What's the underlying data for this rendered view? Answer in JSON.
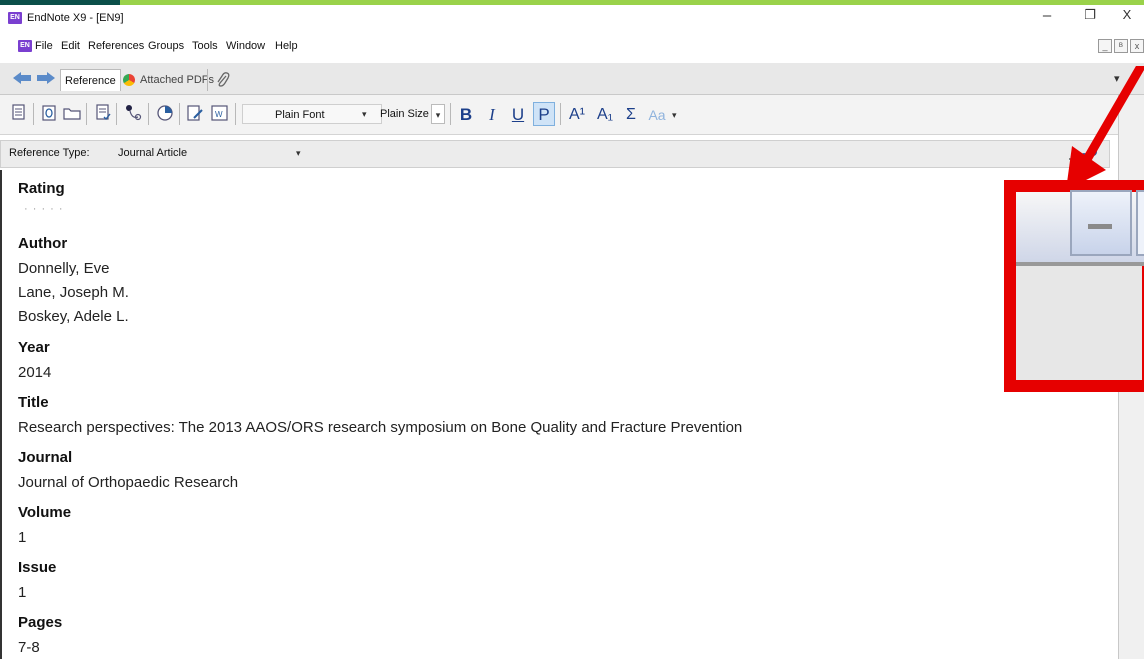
{
  "window": {
    "title": "EndNote X9 - [EN9]",
    "app_icon": "EN",
    "minimize": "–",
    "restore": "❐",
    "close": "X"
  },
  "menu": {
    "items": [
      "File",
      "Edit",
      "References",
      "Groups",
      "Tools",
      "Window",
      "Help"
    ],
    "mdi_buttons": [
      "_",
      "ᴮ",
      "x"
    ]
  },
  "tabs": {
    "reference": "Reference",
    "attached_pdfs": "Attached PDFs",
    "menu_marker": "▾"
  },
  "format": {
    "font": "Plain Font",
    "size": "Plain Size",
    "bold": "B",
    "italic": "I",
    "underline": "U",
    "plain": "P",
    "superscript": "A¹",
    "subscript": "A₁",
    "symbol": "Σ",
    "case": "Aa"
  },
  "reference": {
    "type_label": "Reference Type:",
    "type_value": "Journal Article",
    "fields": [
      {
        "label": "Rating",
        "values": [
          "·   ·   ·   ·   ·"
        ]
      },
      {
        "label": "Author",
        "values": [
          "Donnelly, Eve",
          "Lane, Joseph M.",
          "Boskey, Adele L."
        ]
      },
      {
        "label": "Year",
        "values": [
          "2014"
        ]
      },
      {
        "label": "Title",
        "values": [
          "Research perspectives: The 2013 AAOS/ORS research symposium on Bone Quality and Fracture Prevention"
        ]
      },
      {
        "label": "Journal",
        "values": [
          "Journal of Orthopaedic Research"
        ]
      },
      {
        "label": "Volume",
        "values": [
          "1"
        ]
      },
      {
        "label": "Issue",
        "values": [
          "1"
        ]
      },
      {
        "label": "Pages",
        "values": [
          "7-8"
        ]
      }
    ]
  },
  "icons": {
    "back": "back-arrow-icon",
    "forward": "forward-arrow-icon",
    "pdf": "chrome-pdf-icon",
    "paperclip": "paperclip-icon",
    "gear": "gear-icon"
  },
  "colors": {
    "accent_dark": "#0b4f49",
    "accent_green": "#9ad24a",
    "highlight": "#e60000",
    "toolbar_blue": "#2a5fa0"
  }
}
